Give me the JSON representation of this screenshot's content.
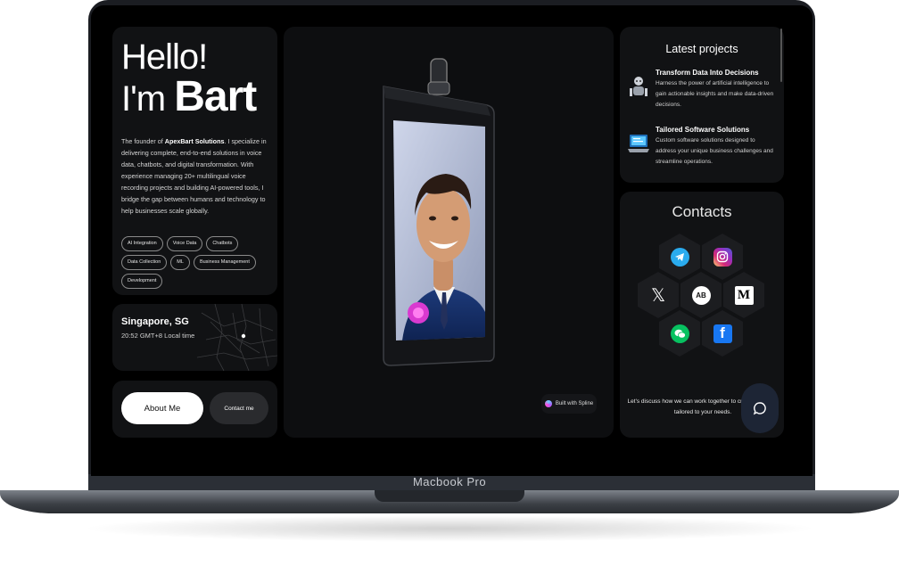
{
  "device": {
    "label": "Macbook Pro"
  },
  "hero": {
    "greeting": "Hello!",
    "intro": "I'm",
    "name": "Bart",
    "bio_prefix": "The founder of",
    "bio_company": "ApexBart Solutions",
    "bio_rest": ". I specialize in delivering complete, end-to-end solutions in voice data, chatbots, and digital transformation. With experience managing 20+ multilingual voice recording projects and building AI-powered tools, I bridge the gap between humans and technology to help businesses scale globally.",
    "tags": [
      "AI Integration",
      "Voice Data",
      "Chatbots",
      "Data Collection",
      "ML",
      "Business Management",
      "Development"
    ]
  },
  "location": {
    "city": "Singapore, SG",
    "time": "20:52 GMT+8 Local time"
  },
  "cta": {
    "about": "About Me",
    "contact": "Contact me"
  },
  "center": {
    "badge": "Built with Spline"
  },
  "projects": {
    "title": "Latest projects",
    "items": [
      {
        "name": "Transform Data Into Decisions",
        "desc": "Harness the power of artificial intelligence to gain actionable insights and make data-driven decisions."
      },
      {
        "name": "Tailored Software Solutions",
        "desc": "Custom software solutions designed to address your unique business challenges and streamline operations."
      }
    ]
  },
  "contacts": {
    "title": "Contacts",
    "text": "Let's discuss how we can work together to create solutions tailored to your needs.",
    "icons": [
      "telegram-icon",
      "instagram-icon",
      "x-icon",
      "ab-logo-icon",
      "medium-icon",
      "wechat-icon",
      "facebook-icon"
    ],
    "colors": {
      "telegram": "#2AABEE",
      "instagram": "#E1306C",
      "wechat": "#07C160",
      "facebook": "#1877F2"
    }
  }
}
